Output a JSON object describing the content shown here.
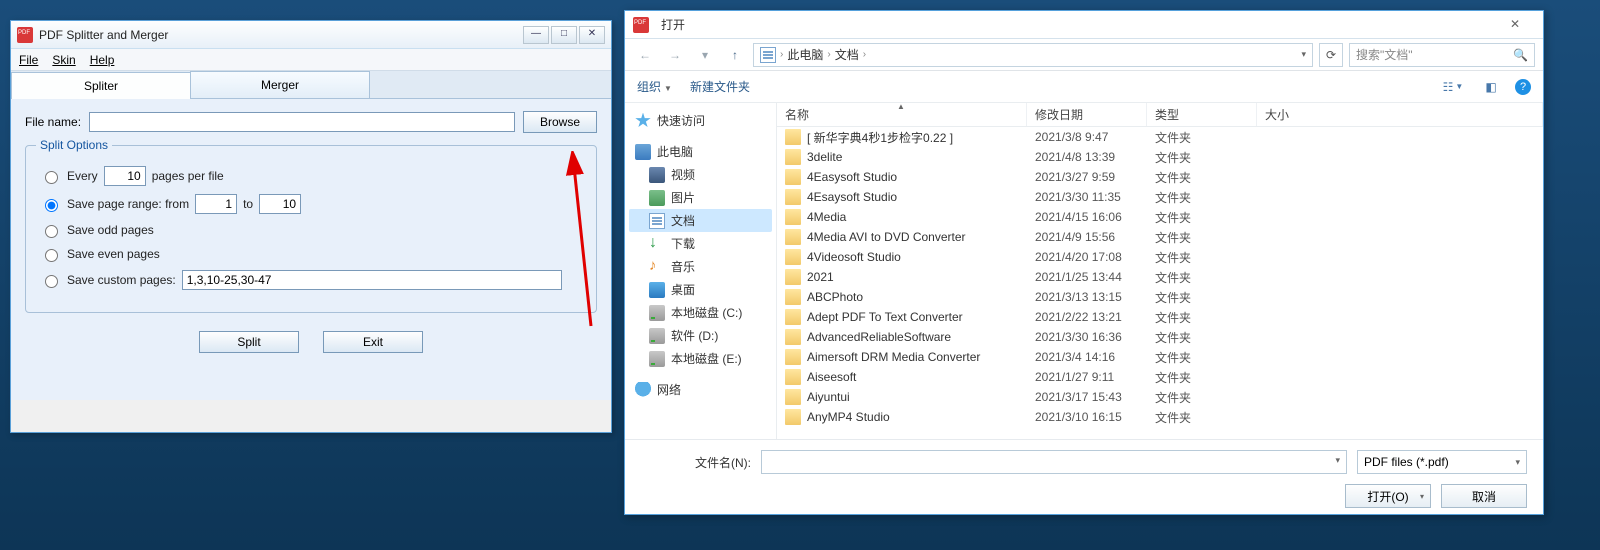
{
  "pdf": {
    "title": "PDF Splitter and Merger",
    "menu": {
      "file": "File",
      "skin": "Skin",
      "help": "Help"
    },
    "tabs": {
      "spliter": "Spliter",
      "merger": "Merger"
    },
    "filename_label": "File name:",
    "filename_value": "",
    "browse": "Browse",
    "fieldset_legend": "Split Options",
    "opt_every_label": "Every",
    "opt_every_value": "10",
    "opt_every_suffix": "pages per file",
    "opt_range_label": "Save page range: from",
    "opt_range_from": "1",
    "opt_range_to_label": "to",
    "opt_range_to": "10",
    "opt_odd": "Save odd pages",
    "opt_even": "Save even pages",
    "opt_custom_label": "Save custom pages:",
    "opt_custom_value": "1,3,10-25,30-47",
    "btn_split": "Split",
    "btn_exit": "Exit"
  },
  "open": {
    "title": "打开",
    "breadcrumb": {
      "root_icon": "pc",
      "p1": "此电脑",
      "p2": "文档"
    },
    "search_placeholder": "搜索\"文档\"",
    "toolbar": {
      "organize": "组织",
      "newfolder": "新建文件夹"
    },
    "tree": [
      {
        "icon": "star",
        "label": "快速访问",
        "indent": 0
      },
      {
        "icon": "pc",
        "label": "此电脑",
        "indent": 0
      },
      {
        "icon": "vid",
        "label": "视频",
        "indent": 1
      },
      {
        "icon": "pic",
        "label": "图片",
        "indent": 1
      },
      {
        "icon": "doc",
        "label": "文档",
        "indent": 1,
        "selected": true
      },
      {
        "icon": "dl",
        "label": "下载",
        "indent": 1
      },
      {
        "icon": "mus",
        "label": "音乐",
        "indent": 1
      },
      {
        "icon": "desk",
        "label": "桌面",
        "indent": 1
      },
      {
        "icon": "drv",
        "label": "本地磁盘 (C:)",
        "indent": 1
      },
      {
        "icon": "drv",
        "label": "软件 (D:)",
        "indent": 1
      },
      {
        "icon": "drv",
        "label": "本地磁盘 (E:)",
        "indent": 1
      },
      {
        "icon": "net",
        "label": "网络",
        "indent": 0
      }
    ],
    "columns": {
      "name": "名称",
      "date": "修改日期",
      "type": "类型",
      "size": "大小"
    },
    "files": [
      {
        "name": "[ 新华字典4秒1步检字0.22 ]",
        "date": "2021/3/8 9:47",
        "type": "文件夹"
      },
      {
        "name": "3delite",
        "date": "2021/4/8 13:39",
        "type": "文件夹"
      },
      {
        "name": "4Easysoft Studio",
        "date": "2021/3/27 9:59",
        "type": "文件夹"
      },
      {
        "name": "4Esaysoft Studio",
        "date": "2021/3/30 11:35",
        "type": "文件夹"
      },
      {
        "name": "4Media",
        "date": "2021/4/15 16:06",
        "type": "文件夹"
      },
      {
        "name": "4Media AVI to DVD Converter",
        "date": "2021/4/9 15:56",
        "type": "文件夹"
      },
      {
        "name": "4Videosoft Studio",
        "date": "2021/4/20 17:08",
        "type": "文件夹"
      },
      {
        "name": "2021",
        "date": "2021/1/25 13:44",
        "type": "文件夹"
      },
      {
        "name": "ABCPhoto",
        "date": "2021/3/13 13:15",
        "type": "文件夹"
      },
      {
        "name": "Adept PDF To Text Converter",
        "date": "2021/2/22 13:21",
        "type": "文件夹"
      },
      {
        "name": "AdvancedReliableSoftware",
        "date": "2021/3/30 16:36",
        "type": "文件夹"
      },
      {
        "name": "Aimersoft DRM Media Converter",
        "date": "2021/3/4 14:16",
        "type": "文件夹"
      },
      {
        "name": "Aiseesoft",
        "date": "2021/1/27 9:11",
        "type": "文件夹"
      },
      {
        "name": "Aiyuntui",
        "date": "2021/3/17 15:43",
        "type": "文件夹"
      },
      {
        "name": "AnyMP4 Studio",
        "date": "2021/3/10 16:15",
        "type": "文件夹"
      }
    ],
    "filename_label": "文件名(N):",
    "filename_value": "",
    "filter": "PDF files (*.pdf)",
    "btn_open": "打开(O)",
    "btn_cancel": "取消"
  }
}
